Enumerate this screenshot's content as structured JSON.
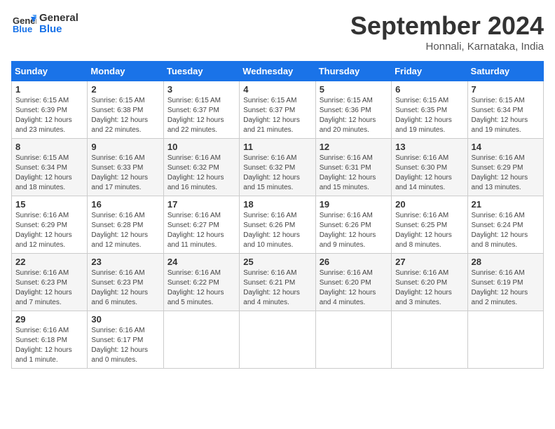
{
  "header": {
    "logo_line1": "General",
    "logo_line2": "Blue",
    "month_title": "September 2024",
    "location": "Honnali, Karnataka, India"
  },
  "weekdays": [
    "Sunday",
    "Monday",
    "Tuesday",
    "Wednesday",
    "Thursday",
    "Friday",
    "Saturday"
  ],
  "weeks": [
    [
      {
        "day": "1",
        "sunrise": "6:15 AM",
        "sunset": "6:39 PM",
        "daylight": "12 hours and 23 minutes."
      },
      {
        "day": "2",
        "sunrise": "6:15 AM",
        "sunset": "6:38 PM",
        "daylight": "12 hours and 22 minutes."
      },
      {
        "day": "3",
        "sunrise": "6:15 AM",
        "sunset": "6:37 PM",
        "daylight": "12 hours and 22 minutes."
      },
      {
        "day": "4",
        "sunrise": "6:15 AM",
        "sunset": "6:37 PM",
        "daylight": "12 hours and 21 minutes."
      },
      {
        "day": "5",
        "sunrise": "6:15 AM",
        "sunset": "6:36 PM",
        "daylight": "12 hours and 20 minutes."
      },
      {
        "day": "6",
        "sunrise": "6:15 AM",
        "sunset": "6:35 PM",
        "daylight": "12 hours and 19 minutes."
      },
      {
        "day": "7",
        "sunrise": "6:15 AM",
        "sunset": "6:34 PM",
        "daylight": "12 hours and 19 minutes."
      }
    ],
    [
      {
        "day": "8",
        "sunrise": "6:15 AM",
        "sunset": "6:34 PM",
        "daylight": "12 hours and 18 minutes."
      },
      {
        "day": "9",
        "sunrise": "6:16 AM",
        "sunset": "6:33 PM",
        "daylight": "12 hours and 17 minutes."
      },
      {
        "day": "10",
        "sunrise": "6:16 AM",
        "sunset": "6:32 PM",
        "daylight": "12 hours and 16 minutes."
      },
      {
        "day": "11",
        "sunrise": "6:16 AM",
        "sunset": "6:32 PM",
        "daylight": "12 hours and 15 minutes."
      },
      {
        "day": "12",
        "sunrise": "6:16 AM",
        "sunset": "6:31 PM",
        "daylight": "12 hours and 15 minutes."
      },
      {
        "day": "13",
        "sunrise": "6:16 AM",
        "sunset": "6:30 PM",
        "daylight": "12 hours and 14 minutes."
      },
      {
        "day": "14",
        "sunrise": "6:16 AM",
        "sunset": "6:29 PM",
        "daylight": "12 hours and 13 minutes."
      }
    ],
    [
      {
        "day": "15",
        "sunrise": "6:16 AM",
        "sunset": "6:29 PM",
        "daylight": "12 hours and 12 minutes."
      },
      {
        "day": "16",
        "sunrise": "6:16 AM",
        "sunset": "6:28 PM",
        "daylight": "12 hours and 12 minutes."
      },
      {
        "day": "17",
        "sunrise": "6:16 AM",
        "sunset": "6:27 PM",
        "daylight": "12 hours and 11 minutes."
      },
      {
        "day": "18",
        "sunrise": "6:16 AM",
        "sunset": "6:26 PM",
        "daylight": "12 hours and 10 minutes."
      },
      {
        "day": "19",
        "sunrise": "6:16 AM",
        "sunset": "6:26 PM",
        "daylight": "12 hours and 9 minutes."
      },
      {
        "day": "20",
        "sunrise": "6:16 AM",
        "sunset": "6:25 PM",
        "daylight": "12 hours and 8 minutes."
      },
      {
        "day": "21",
        "sunrise": "6:16 AM",
        "sunset": "6:24 PM",
        "daylight": "12 hours and 8 minutes."
      }
    ],
    [
      {
        "day": "22",
        "sunrise": "6:16 AM",
        "sunset": "6:23 PM",
        "daylight": "12 hours and 7 minutes."
      },
      {
        "day": "23",
        "sunrise": "6:16 AM",
        "sunset": "6:23 PM",
        "daylight": "12 hours and 6 minutes."
      },
      {
        "day": "24",
        "sunrise": "6:16 AM",
        "sunset": "6:22 PM",
        "daylight": "12 hours and 5 minutes."
      },
      {
        "day": "25",
        "sunrise": "6:16 AM",
        "sunset": "6:21 PM",
        "daylight": "12 hours and 4 minutes."
      },
      {
        "day": "26",
        "sunrise": "6:16 AM",
        "sunset": "6:20 PM",
        "daylight": "12 hours and 4 minutes."
      },
      {
        "day": "27",
        "sunrise": "6:16 AM",
        "sunset": "6:20 PM",
        "daylight": "12 hours and 3 minutes."
      },
      {
        "day": "28",
        "sunrise": "6:16 AM",
        "sunset": "6:19 PM",
        "daylight": "12 hours and 2 minutes."
      }
    ],
    [
      {
        "day": "29",
        "sunrise": "6:16 AM",
        "sunset": "6:18 PM",
        "daylight": "12 hours and 1 minute."
      },
      {
        "day": "30",
        "sunrise": "6:16 AM",
        "sunset": "6:17 PM",
        "daylight": "12 hours and 0 minutes."
      },
      null,
      null,
      null,
      null,
      null
    ]
  ]
}
